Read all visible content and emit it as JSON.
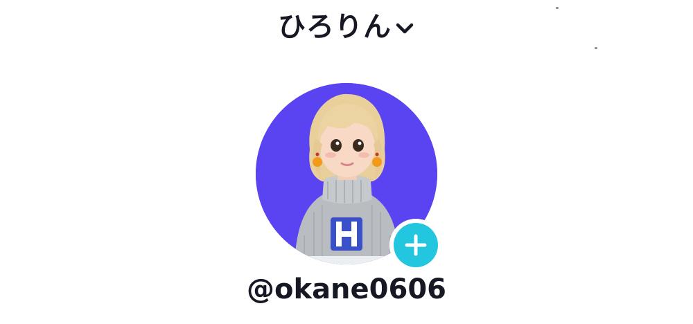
{
  "header": {
    "display_name": "ひろりん",
    "switch_icon": "chevron-down-icon"
  },
  "profile": {
    "avatar_description_icon": "avatar-image",
    "avatar_bg_color": "#5a44f2",
    "add_icon": "plus-icon",
    "add_badge_color": "#22c6de",
    "username": "@okane0606"
  }
}
